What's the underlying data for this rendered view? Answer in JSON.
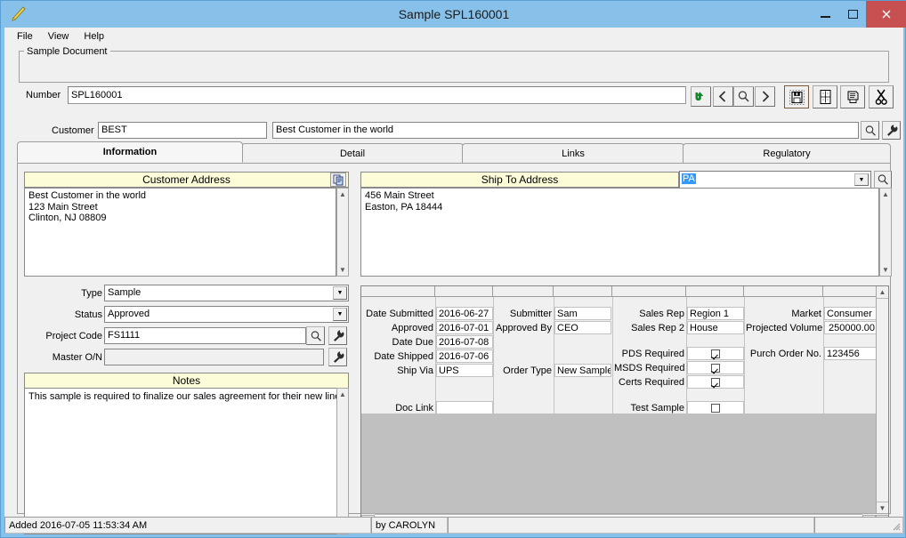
{
  "window": {
    "title": "Sample SPL160001",
    "icon": "pencil-icon",
    "buttons": {
      "minimize": "–",
      "maximize": "□",
      "close": "✕"
    }
  },
  "menubar": {
    "items": [
      "File",
      "View",
      "Help"
    ]
  },
  "sample_document": {
    "legend": "Sample Document",
    "number_label": "Number",
    "number_value": "SPL160001",
    "toolbar": [
      {
        "name": "undo-icon",
        "title": "Undo"
      },
      {
        "name": "previous-record-icon",
        "title": "Previous"
      },
      {
        "name": "search-icon",
        "title": "Find"
      },
      {
        "name": "next-record-icon",
        "title": "Next"
      },
      {
        "name": "save-icon",
        "title": "Save"
      },
      {
        "name": "grid-icon",
        "title": "Grid"
      },
      {
        "name": "print-icon",
        "title": "Print"
      },
      {
        "name": "cut-icon",
        "title": "Cut"
      }
    ]
  },
  "customer": {
    "label": "Customer",
    "code": "BEST",
    "name": "Best Customer in the world",
    "search_icon": "search-icon",
    "tools_icon": "wrench-icon"
  },
  "tabs": [
    {
      "label": "Information",
      "active": true
    },
    {
      "label": "Detail",
      "active": false
    },
    {
      "label": "Links",
      "active": false
    },
    {
      "label": "Regulatory",
      "active": false
    }
  ],
  "customer_address": {
    "title": "Customer Address",
    "copy_icon": "copy-icon",
    "text": "Best Customer in the world\n123 Main Street\nClinton, NJ 08809"
  },
  "ship_to_address": {
    "title": "Ship To Address",
    "selector_value": "PA",
    "search_icon": "search-icon",
    "text": "456 Main Street\nEaston, PA 18444"
  },
  "form": {
    "type": {
      "label": "Type",
      "value": "Sample"
    },
    "status": {
      "label": "Status",
      "value": "Approved"
    },
    "project_code": {
      "label": "Project Code",
      "value": "FS1111",
      "search_icon": "search-icon",
      "tools_icon": "wrench-icon"
    },
    "master_on": {
      "label": "Master O/N",
      "value": "",
      "tools_icon": "wrench-icon"
    }
  },
  "notes": {
    "title": "Notes",
    "text": "This sample is required to finalize our sales agreement for their new line"
  },
  "detail_grid": {
    "fields": [
      {
        "label": "Date Submitted",
        "value": "2016-06-27",
        "type": "text"
      },
      {
        "label": "Approved",
        "value": "2016-07-01",
        "type": "text"
      },
      {
        "label": "Date Due",
        "value": "2016-07-08",
        "type": "text"
      },
      {
        "label": "Date Shipped",
        "value": "2016-07-06",
        "type": "text"
      },
      {
        "label": "Ship Via",
        "value": "UPS",
        "type": "text"
      },
      {
        "label": "Doc Link",
        "value": "",
        "type": "text"
      },
      {
        "label": "Submitter",
        "value": "Sam",
        "type": "text"
      },
      {
        "label": "Approved By",
        "value": "CEO",
        "type": "text"
      },
      {
        "label": "Order Type",
        "value": "New Sample",
        "type": "text"
      },
      {
        "label": "Sales Rep",
        "value": "Region 1",
        "type": "text"
      },
      {
        "label": "Sales Rep 2",
        "value": "House",
        "type": "text"
      },
      {
        "label": "PDS Required",
        "value": true,
        "type": "checkbox"
      },
      {
        "label": "MSDS Required",
        "value": true,
        "type": "checkbox"
      },
      {
        "label": "Certs Required",
        "value": true,
        "type": "checkbox"
      },
      {
        "label": "Test Sample",
        "value": false,
        "type": "checkbox"
      },
      {
        "label": "Market",
        "value": "Consumer",
        "type": "text"
      },
      {
        "label": "Projected Volume",
        "value": "250000.00",
        "type": "number"
      },
      {
        "label": "Purch Order No.",
        "value": "123456",
        "type": "text"
      }
    ]
  },
  "statusbar": {
    "added": "Added 2016-07-05 11:53:34 AM",
    "by": "by CAROLYN",
    "extra": "",
    "extra2": ""
  },
  "colors": {
    "titlebar": "#87c1ea",
    "close_button": "#c75050",
    "panel_header": "#fcfcd8",
    "face": "#f0f0f0",
    "selection": "#3399ff",
    "grid_empty": "#c0c0c0"
  }
}
